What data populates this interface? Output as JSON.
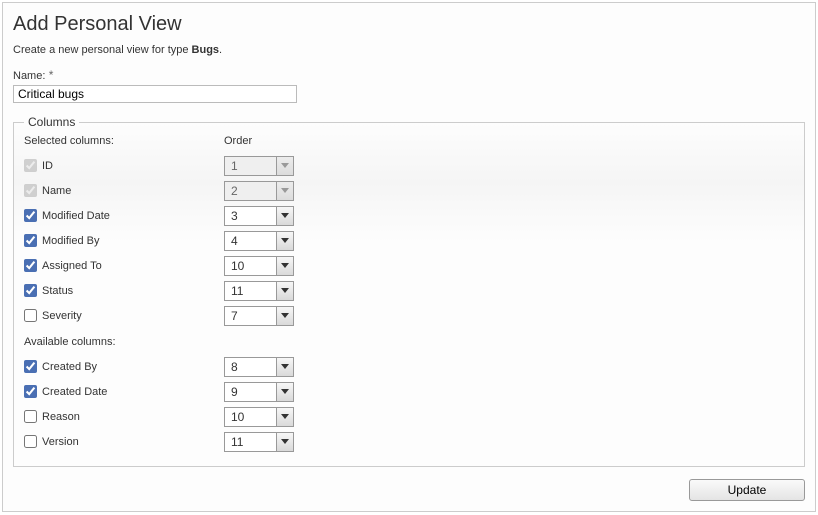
{
  "title": "Add Personal View",
  "intro_prefix": "Create a new personal view for type ",
  "intro_type": "Bugs",
  "intro_suffix": ".",
  "name_label": "Name:",
  "name_required_mark": "*",
  "name_value": "Critical bugs",
  "columns_legend": "Columns",
  "selected_header": "Selected columns:",
  "order_header": "Order",
  "available_header": "Available columns:",
  "selected": [
    {
      "label": "ID",
      "checked": true,
      "locked": true,
      "order": "1"
    },
    {
      "label": "Name",
      "checked": true,
      "locked": true,
      "order": "2"
    },
    {
      "label": "Modified Date",
      "checked": true,
      "locked": false,
      "order": "3"
    },
    {
      "label": "Modified By",
      "checked": true,
      "locked": false,
      "order": "4"
    },
    {
      "label": "Assigned To",
      "checked": true,
      "locked": false,
      "order": "10"
    },
    {
      "label": "Status",
      "checked": true,
      "locked": false,
      "order": "11"
    },
    {
      "label": "Severity",
      "checked": false,
      "locked": false,
      "order": "7"
    }
  ],
  "available": [
    {
      "label": "Created By",
      "checked": true,
      "order": "8"
    },
    {
      "label": "Created Date",
      "checked": true,
      "order": "9"
    },
    {
      "label": "Reason",
      "checked": false,
      "order": "10"
    },
    {
      "label": "Version",
      "checked": false,
      "order": "11"
    }
  ],
  "update_label": "Update"
}
